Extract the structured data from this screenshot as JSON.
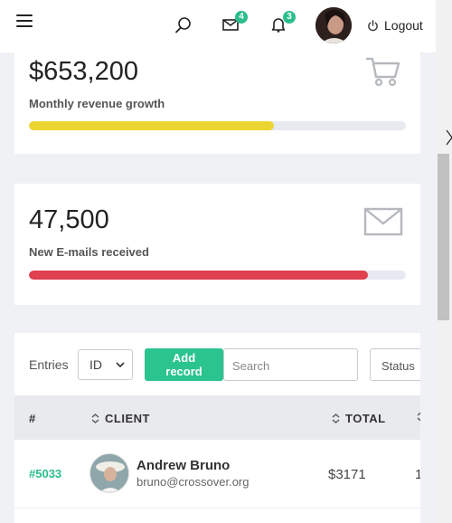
{
  "header": {
    "mail_badge": "4",
    "notification_badge": "3",
    "logout_label": "Logout"
  },
  "stats": [
    {
      "value": "$653,200",
      "label": "Monthly revenue growth",
      "progress": 0.65,
      "color": "#ecd530",
      "icon": "cart-icon"
    },
    {
      "value": "47,500",
      "label": "New E-mails received",
      "progress": 0.9,
      "color": "#e0404f",
      "icon": "envelope-icon"
    }
  ],
  "table": {
    "entries_label": "Entries",
    "entries_value": "ID",
    "add_record_label": "Add\nrecord",
    "search_placeholder": "Search",
    "status_label": "Status",
    "columns": [
      "#",
      "CLIENT",
      "TOTAL"
    ],
    "rows": [
      {
        "id": "#5033",
        "name": "Andrew Bruno",
        "email": "bruno@crossover.org",
        "total": "$3171",
        "next": "1"
      }
    ]
  }
}
